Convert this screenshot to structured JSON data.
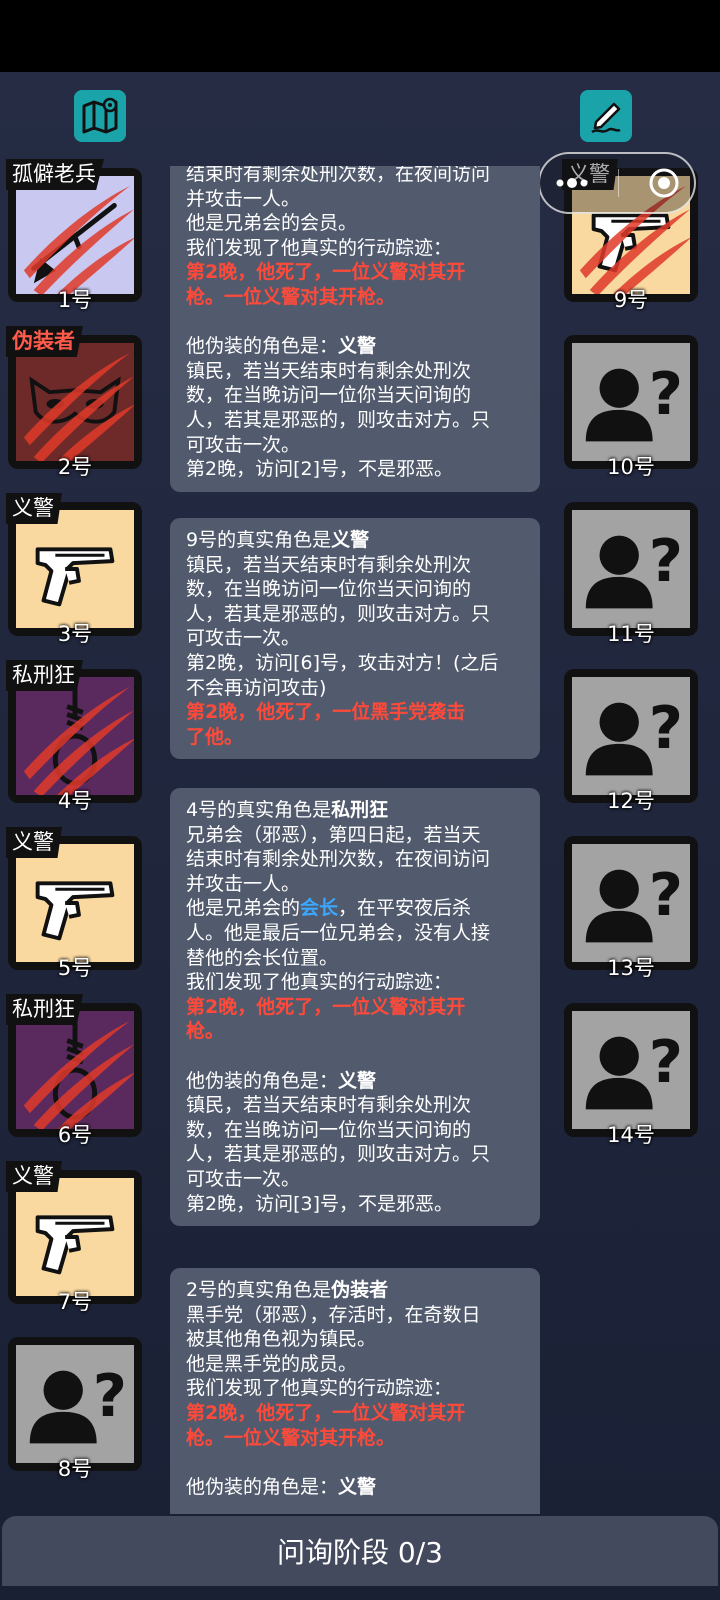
{
  "toolbar": {
    "map_icon": "map-pin-icon",
    "edit_icon": "pencil-icon"
  },
  "capsule": {
    "more_icon": "more-dots-icon",
    "close_icon": "target-circle-icon"
  },
  "left_cards": [
    {
      "role": "孤僻老兵",
      "num": "1号",
      "icon": "rifle-icon",
      "bg": "#c8c8f0",
      "dead": true
    },
    {
      "role": "伪装者",
      "num": "2号",
      "icon": "mask-icon",
      "bg": "#6e2a28",
      "dead": true
    },
    {
      "role": "义警",
      "num": "3号",
      "icon": "pistol-icon",
      "bg": "#f9d9a0",
      "dead": false
    },
    {
      "role": "私刑狂",
      "num": "4号",
      "icon": "noose-icon",
      "bg": "#5a2a5e",
      "dead": true
    },
    {
      "role": "义警",
      "num": "5号",
      "icon": "pistol-icon",
      "bg": "#f9d9a0",
      "dead": false
    },
    {
      "role": "私刑狂",
      "num": "6号",
      "icon": "noose-icon",
      "bg": "#5a2a5e",
      "dead": true
    },
    {
      "role": "义警",
      "num": "7号",
      "icon": "pistol-icon",
      "bg": "#f9d9a0",
      "dead": false
    },
    {
      "role": "",
      "num": "8号",
      "icon": "unknown-person-icon",
      "bg": "#a3a3a3",
      "dead": false
    }
  ],
  "right_cards": [
    {
      "role": "义警",
      "num": "9号",
      "icon": "pistol-icon",
      "bg": "#f9d9a0",
      "dead": true
    },
    {
      "role": "",
      "num": "10号",
      "icon": "unknown-person-icon",
      "bg": "#a3a3a3",
      "dead": false
    },
    {
      "role": "",
      "num": "11号",
      "icon": "unknown-person-icon",
      "bg": "#a3a3a3",
      "dead": false
    },
    {
      "role": "",
      "num": "12号",
      "icon": "unknown-person-icon",
      "bg": "#a3a3a3",
      "dead": false
    },
    {
      "role": "",
      "num": "13号",
      "icon": "unknown-person-icon",
      "bg": "#a3a3a3",
      "dead": false
    },
    {
      "role": "",
      "num": "14号",
      "icon": "unknown-person-icon",
      "bg": "#a3a3a3",
      "dead": false
    }
  ],
  "log": {
    "box1": {
      "l1": "结束时有剩余处刑次数，在夜间访问",
      "l2": "并攻击一人。",
      "l3": "他是兄弟会的会员。",
      "l4": "我们发现了他真实的行动踪迹：",
      "l5": "第2晚，他死了，一位义警对其开",
      "l6": "枪。一位义警对其开枪。",
      "l7a": "他伪装的角色是：",
      "l7b": "义警",
      "l8": "镇民，若当天结束时有剩余处刑次",
      "l9": "数，在当晚访问一位你当天问询的",
      "l10": "人，若其是邪恶的，则攻击对方。只",
      "l11": "可攻击一次。",
      "l12": "第2晚，访问[2]号，不是邪恶。"
    },
    "box2": {
      "l1a": "9号的真实角色是",
      "l1b": "义警",
      "l2": "镇民，若当天结束时有剩余处刑次",
      "l3": "数，在当晚访问一位你当天问询的",
      "l4": "人，若其是邪恶的，则攻击对方。只",
      "l5": "可攻击一次。",
      "l6": "第2晚，访问[6]号，攻击对方！(之后",
      "l7": "不会再访问攻击)",
      "l8": "第2晚，他死了，一位黑手党袭击",
      "l9": "了他。"
    },
    "box3": {
      "l1a": "4号的真实角色是",
      "l1b": "私刑狂",
      "l2": "兄弟会（邪恶），第四日起，若当天",
      "l3": "结束时有剩余处刑次数，在夜间访问",
      "l4": "并攻击一人。",
      "l5a": "他是兄弟会的",
      "l5b": "会长",
      "l5c": "，在平安夜后杀",
      "l6": "人。他是最后一位兄弟会，没有人接",
      "l7": "替他的会长位置。",
      "l8": "我们发现了他真实的行动踪迹：",
      "l9": "第2晚，他死了，一位义警对其开",
      "l10": "枪。",
      "l11a": "他伪装的角色是：",
      "l11b": "义警",
      "l12": "镇民，若当天结束时有剩余处刑次",
      "l13": "数，在当晚访问一位你当天问询的",
      "l14": "人，若其是邪恶的，则攻击对方。只",
      "l15": "可攻击一次。",
      "l16": "第2晚，访问[3]号，不是邪恶。"
    },
    "box4": {
      "l1a": "2号的真实角色是",
      "l1b": "伪装者",
      "l2": "黑手党（邪恶），存活时，在奇数日",
      "l3": "被其他角色视为镇民。",
      "l4": "他是黑手党的成员。",
      "l5": "我们发现了他真实的行动踪迹：",
      "l6": "第2晚，他死了，一位义警对其开",
      "l7": "枪。一位义警对其开枪。",
      "l8a": "他伪装的角色是：",
      "l8b": "义警"
    }
  },
  "bottom": {
    "phase": "问询阶段 0/3"
  }
}
